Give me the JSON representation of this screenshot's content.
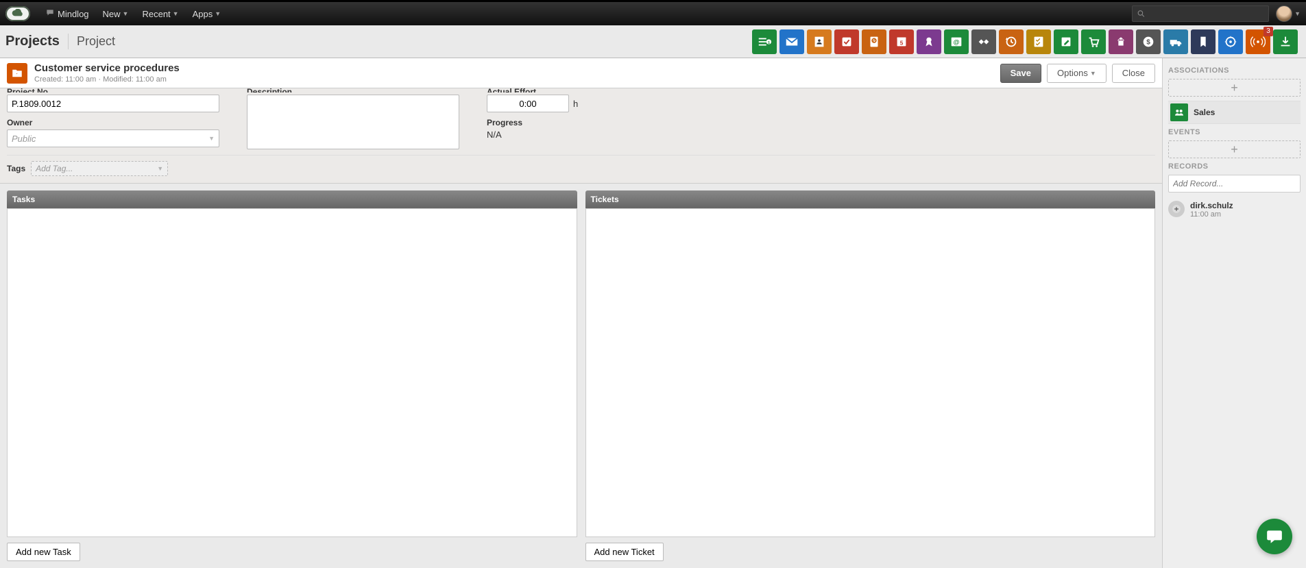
{
  "nav": {
    "mindlog": "Mindlog",
    "new": "New",
    "recent": "Recent",
    "apps": "Apps"
  },
  "breadcrumb": {
    "root": "Projects",
    "current": "Project"
  },
  "action_icons": [
    {
      "name": "money-list-icon",
      "color": "#1c8a3a"
    },
    {
      "name": "mail-icon",
      "color": "#2273c9"
    },
    {
      "name": "contacts-icon",
      "color": "#d67a1e"
    },
    {
      "name": "check-icon",
      "color": "#c0392b"
    },
    {
      "name": "badge-check-icon",
      "color": "#c96312"
    },
    {
      "name": "calendar-5-icon",
      "color": "#c0392b"
    },
    {
      "name": "award-icon",
      "color": "#7c3a8f"
    },
    {
      "name": "at-list-icon",
      "color": "#1c8a3a"
    },
    {
      "name": "handshake-icon",
      "color": "#555555"
    },
    {
      "name": "history-icon",
      "color": "#c96312"
    },
    {
      "name": "checklist-icon",
      "color": "#b8860b"
    },
    {
      "name": "edit-icon",
      "color": "#1c8a3a"
    },
    {
      "name": "cart-icon",
      "color": "#1c8a3a"
    },
    {
      "name": "podium-icon",
      "color": "#8a3a6f"
    },
    {
      "name": "dollar-circle-icon",
      "color": "#555555"
    },
    {
      "name": "truck-icon",
      "color": "#2a7ba8"
    },
    {
      "name": "bookmark-icon",
      "color": "#2e3a5a"
    },
    {
      "name": "recycle-icon",
      "color": "#2273c9"
    },
    {
      "name": "broadcast-icon",
      "color": "#d35400",
      "badge": "3"
    },
    {
      "name": "download-icon",
      "color": "#1c8a3a"
    }
  ],
  "project": {
    "title": "Customer service procedures",
    "created_label": "Created:",
    "created_time": "11:00 am",
    "modified_label": "Modified:",
    "modified_time": "11:00 am",
    "save": "Save",
    "options": "Options",
    "close": "Close"
  },
  "form": {
    "project_no_label": "Project No.",
    "project_no_value": "P.1809.0012",
    "owner_label": "Owner",
    "owner_value": "Public",
    "description_label": "Description",
    "description_value": "",
    "actual_effort_label": "Actual Effort",
    "actual_effort_value": "0:00",
    "actual_effort_unit": "h",
    "progress_label": "Progress",
    "progress_value": "N/A",
    "tags_label": "Tags",
    "tags_placeholder": "Add Tag..."
  },
  "panels": {
    "tasks": {
      "title": "Tasks",
      "add": "Add new Task"
    },
    "tickets": {
      "title": "Tickets",
      "add": "Add new Ticket"
    }
  },
  "side": {
    "assoc_title": "ASSOCIATIONS",
    "assoc_items": [
      {
        "label": "Sales"
      }
    ],
    "events_title": "EVENTS",
    "records_title": "RECORDS",
    "records_placeholder": "Add Record...",
    "records": [
      {
        "name": "dirk.schulz",
        "time": "11:00 am"
      }
    ]
  }
}
